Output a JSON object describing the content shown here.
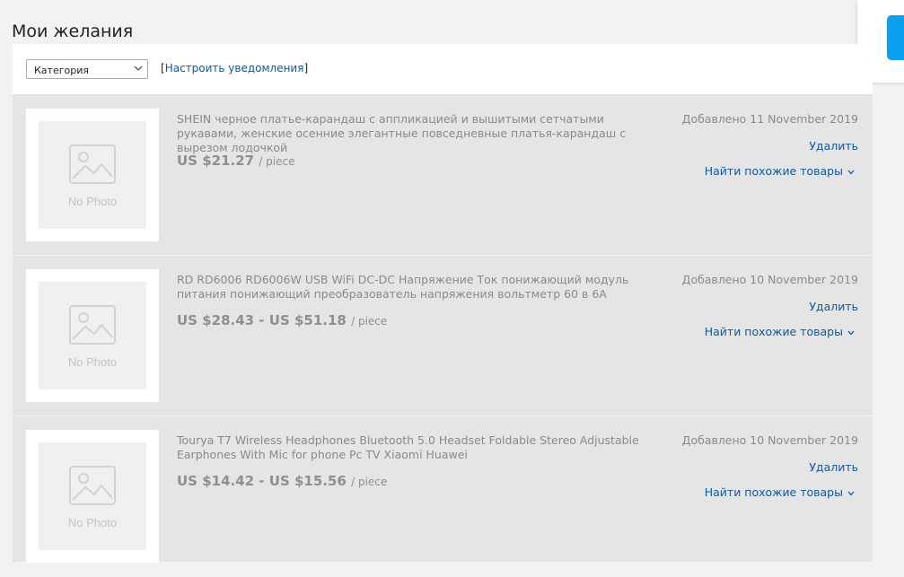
{
  "page": {
    "title": "Мои желания"
  },
  "toolbar": {
    "category_select": "Категория",
    "notify_bracket_open": "[",
    "notify_link": "Настроить уведомления",
    "notify_bracket_close": "]"
  },
  "labels": {
    "no_photo": "No Photo",
    "delete": "Удалить",
    "find_similar": "Найти похожие товары"
  },
  "items": [
    {
      "title": "SHEIN черное платье-карандаш с аппликацией и вышитыми сетчатыми рукавами, женские осенние элегантные повседневные платья-карандаш с вырезом лодочкой",
      "price": "US $21.27",
      "unit": "/ piece",
      "added": "Добавлено 11 November 2019"
    },
    {
      "title": "RD RD6006 RD6006W USB WiFi DC-DC Напряжение Ток понижающий модуль питания понижающий преобразователь напряжения вольтметр 60 в 6А",
      "price": "US $28.43 - US $51.18",
      "unit": "/ piece",
      "added": "Добавлено 10 November 2019"
    },
    {
      "title": "Tourya T7 Wireless Headphones Bluetooth 5.0 Headset Foldable Stereo Adjustable Earphones With Mic for phone Pc TV Xiaomi Huawei",
      "price": "US $14.42 - US $15.56",
      "unit": "/ piece",
      "added": "Добавлено 10 November 2019"
    }
  ]
}
